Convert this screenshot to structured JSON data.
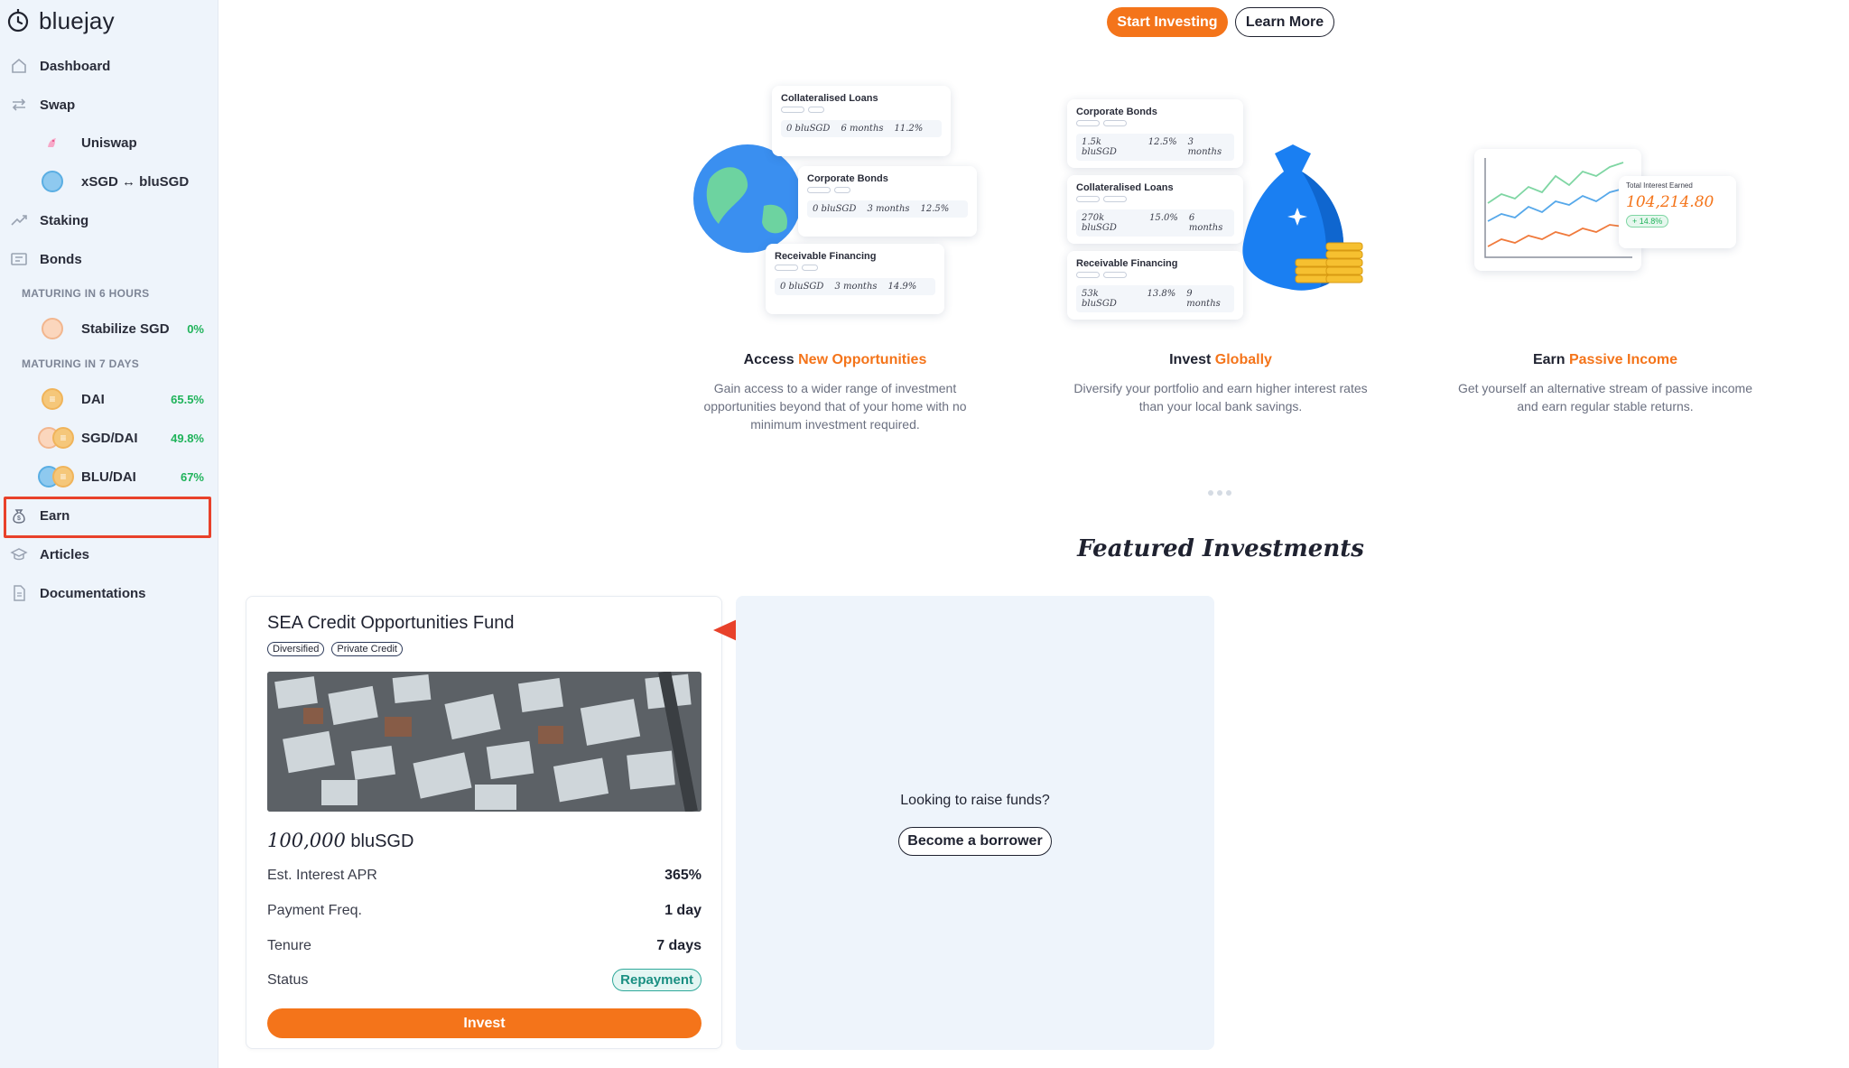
{
  "brand": {
    "name": "bluejay",
    "logo_icon": "bluejay-logo-icon"
  },
  "sidebar": {
    "items": [
      {
        "label": "Dashboard",
        "icon": "home-icon"
      },
      {
        "label": "Swap",
        "icon": "swap-arrows-icon"
      },
      {
        "label": "Uniswap",
        "icon": "uniswap-unicorn-icon"
      },
      {
        "label": "xSGD ↔ bluSGD",
        "icon": "blusgd-coin-icon"
      },
      {
        "label": "Staking",
        "icon": "trend-up-icon"
      },
      {
        "label": "Bonds",
        "icon": "bond-ticket-icon"
      },
      {
        "label": "Stabilize SGD",
        "pct": "0%"
      },
      {
        "label": "DAI",
        "pct": "65.5%"
      },
      {
        "label": "SGD/DAI",
        "pct": "49.8%"
      },
      {
        "label": "BLU/DAI",
        "pct": "67%"
      },
      {
        "label": "Earn",
        "icon": "money-bag-icon"
      },
      {
        "label": "Articles",
        "icon": "article-icon"
      },
      {
        "label": "Documentations",
        "icon": "document-icon"
      }
    ],
    "sections": {
      "six_hours": "MATURING IN 6 HOURS",
      "seven_days": "MATURING IN 7 DAYS"
    },
    "highlight_color": "#e8412a",
    "pct_color": "#1fb35a"
  },
  "header": {
    "start_label": "Start Investing",
    "learn_label": "Learn More"
  },
  "features": [
    {
      "title_prefix": "Access ",
      "title_accent": "New Opportunities",
      "desc": "Gain access to a wider range of investment opportunities beyond that of your home with no minimum investment required.",
      "cards": [
        {
          "title": "Collateralised Loans",
          "amount": "0 bluSGD",
          "tenure": "6 months",
          "apr": "11.2%"
        },
        {
          "title": "Corporate Bonds",
          "amount": "0 bluSGD",
          "tenure": "3 months",
          "apr": "12.5%"
        },
        {
          "title": "Receivable Financing",
          "amount": "0 bluSGD",
          "tenure": "3 months",
          "apr": "14.9%"
        }
      ]
    },
    {
      "title_prefix": "Invest ",
      "title_accent": "Globally",
      "desc": "Diversify your portfolio and earn higher interest rates than your local bank savings.",
      "cards": [
        {
          "title": "Corporate Bonds",
          "amount": "1.5k bluSGD",
          "apr": "12.5%",
          "tenure": "3 months"
        },
        {
          "title": "Collateralised Loans",
          "amount": "270k bluSGD",
          "apr": "15.0%",
          "tenure": "6 months"
        },
        {
          "title": "Receivable Financing",
          "amount": "53k bluSGD",
          "apr": "13.8%",
          "tenure": "9 months"
        }
      ]
    },
    {
      "title_prefix": "Earn ",
      "title_accent": "Passive Income",
      "desc": "Get yourself an alternative stream of passive income and earn regular stable returns.",
      "widget": {
        "label": "Total Interest Earned",
        "value": "104,214.80",
        "change": "+ 14.8%"
      }
    }
  ],
  "featured": {
    "title": "Featured Investments"
  },
  "investment": {
    "title": "SEA Credit Opportunities Fund",
    "tags": [
      "Diversified",
      "Private Credit"
    ],
    "amount_num": "100,000",
    "amount_unit": "bluSGD",
    "rows": [
      {
        "k": "Est. Interest APR",
        "v": "365%"
      },
      {
        "k": "Payment Freq.",
        "v": "1 day"
      },
      {
        "k": "Tenure",
        "v": "7 days"
      },
      {
        "k": "Status",
        "v": "Repayment"
      }
    ],
    "invest_label": "Invest"
  },
  "raise": {
    "text": "Looking to raise funds?",
    "button": "Become a borrower"
  },
  "colors": {
    "accent": "#f4741a",
    "sidebar_bg": "#eef4fb",
    "annotation": "#e8412a"
  }
}
